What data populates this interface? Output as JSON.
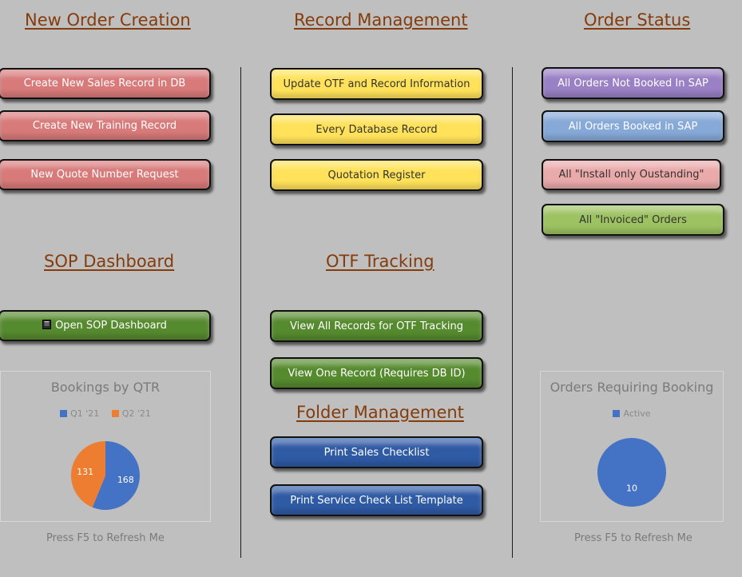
{
  "sections": {
    "new_order": "New Order Creation",
    "record_mgmt": "Record Management",
    "order_status": "Order Status",
    "sop_dashboard": "SOP Dashboard",
    "otf_tracking": "OTF Tracking",
    "folder_mgmt": "Folder Management"
  },
  "buttons": {
    "create_sales_record": "Create New Sales Record in DB",
    "create_training_record": "Create New Training Record",
    "new_quote_request": "New Quote Number Request",
    "update_otf": "Update OTF and Record Information",
    "every_db_record": "Every Database Record",
    "quotation_register": "Quotation Register",
    "not_booked_sap": "All Orders Not Booked In SAP",
    "booked_sap": "All Orders Booked in SAP",
    "install_only": "All \"Install only Oustanding\"",
    "invoiced": "All \"Invoiced\" Orders",
    "open_sop": "Open SOP Dashboard",
    "view_all_otf": "View All Records for OTF Tracking",
    "view_one_record": "View One Record (Requires DB ID)",
    "print_sales_checklist": "Print Sales Checklist",
    "print_service_checklist": "Print Service Check List Template"
  },
  "icons": {
    "sop_book": "book-icon"
  },
  "refresh_left": "Press F5 to Refresh Me",
  "refresh_right": "Press F5 to Refresh Me",
  "chart_data": [
    {
      "type": "pie",
      "title": "Bookings by QTR",
      "categories": [
        "Q1 '21",
        "Q2 '21"
      ],
      "values": [
        168,
        131
      ],
      "colors": [
        "#4472c4",
        "#ed7d31"
      ],
      "legend": "top"
    },
    {
      "type": "pie",
      "title": "Orders Requiring Booking",
      "categories": [
        "Active"
      ],
      "values": [
        10
      ],
      "colors": [
        "#4472c4"
      ],
      "legend": "top"
    }
  ]
}
